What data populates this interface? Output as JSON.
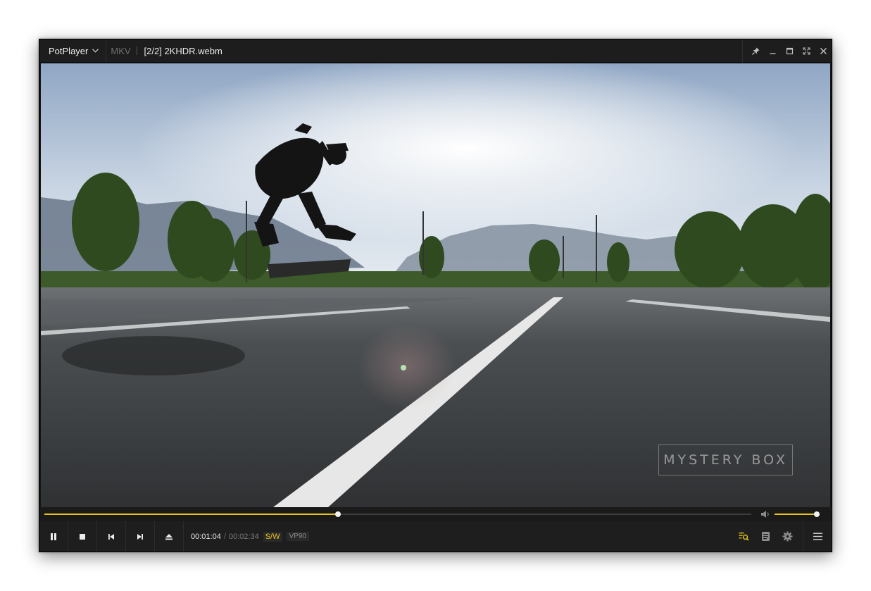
{
  "app": {
    "name": "PotPlayer"
  },
  "titlebar": {
    "container": "MKV",
    "file_title": "[2/2] 2KHDR.webm"
  },
  "video": {
    "watermark": "MYSTERY BOX"
  },
  "playback": {
    "current_time": "00:01:04",
    "separator": "/",
    "total_time": "00:02:34",
    "decoder": "S/W",
    "codec": "VP90",
    "progress_fraction": 0.415,
    "volume_fraction": 0.93
  },
  "colors": {
    "accent": "#e8c21a",
    "window_bg": "#141414",
    "titlebar_bg": "#1d1d1d"
  },
  "icons": {
    "window": [
      "pin-icon",
      "minimize-icon",
      "maximize-icon",
      "fullscreen-icon",
      "close-icon"
    ],
    "transport": [
      "pause-icon",
      "stop-icon",
      "previous-icon",
      "next-icon",
      "eject-icon"
    ],
    "right": [
      "playlist-search-icon",
      "notes-icon",
      "gear-icon",
      "hamburger-menu-icon"
    ]
  }
}
